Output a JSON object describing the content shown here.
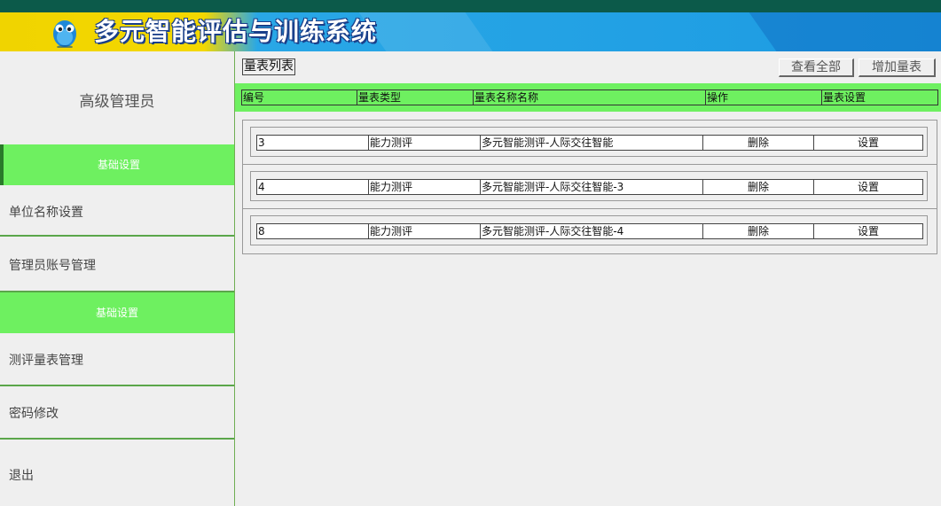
{
  "header": {
    "title": "多元智能评估与训练系统",
    "logo_icon": "blue-mascot-icon",
    "colors": {
      "yellow": "#f0d400",
      "blue": "#1c9be2",
      "topbar": "#0c5a4a"
    }
  },
  "sidebar": {
    "role": "高级管理员",
    "section1": "基础设置",
    "items1": [
      "单位名称设置",
      "管理员账号管理"
    ],
    "section2": "基础设置",
    "items2": [
      "测评量表管理",
      "密码修改",
      "退出"
    ],
    "accent": "#6ef060"
  },
  "main": {
    "list_title": "量表列表",
    "buttons": {
      "view_all": "查看全部",
      "add": "增加量表"
    },
    "columns": [
      "编号",
      "量表类型",
      "量表名称名称",
      "操作",
      "量表设置"
    ],
    "rows": [
      {
        "id": "3",
        "type": "能力测评",
        "name": "多元智能测评-人际交往智能",
        "action": "删除",
        "setting": "设置"
      },
      {
        "id": "4",
        "type": "能力测评",
        "name": "多元智能测评-人际交往智能-3",
        "action": "删除",
        "setting": "设置"
      },
      {
        "id": "8",
        "type": "能力测评",
        "name": "多元智能测评-人际交往智能-4",
        "action": "删除",
        "setting": "设置"
      }
    ]
  }
}
